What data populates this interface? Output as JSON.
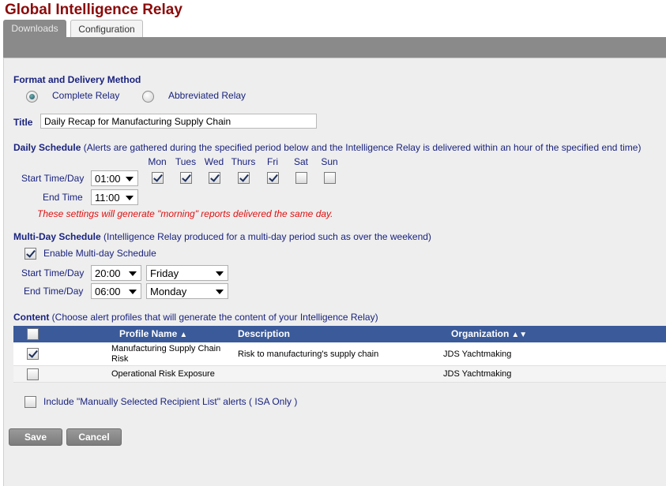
{
  "app": {
    "title": "Global Intelligence Relay"
  },
  "tabs": [
    {
      "label": "Downloads"
    },
    {
      "label": "Configuration"
    }
  ],
  "format": {
    "heading": "Format and Delivery Method",
    "options": [
      {
        "label": "Complete Relay",
        "selected": true
      },
      {
        "label": "Abbreviated Relay",
        "selected": false
      }
    ]
  },
  "title_field": {
    "label": "Title",
    "value": "Daily Recap for Manufacturing Supply Chain"
  },
  "daily": {
    "heading": "Daily Schedule",
    "note": "(Alerts are gathered during the specified period below and the Intelligence Relay is delivered within an hour of the specified end time)",
    "days": [
      {
        "label": "Mon",
        "checked": true
      },
      {
        "label": "Tues",
        "checked": true
      },
      {
        "label": "Wed",
        "checked": true
      },
      {
        "label": "Thurs",
        "checked": true
      },
      {
        "label": "Fri",
        "checked": true
      },
      {
        "label": "Sat",
        "checked": false
      },
      {
        "label": "Sun",
        "checked": false
      }
    ],
    "start_label": "Start Time/Day",
    "start_value": "01:00",
    "end_label": "End Time",
    "end_value": "11:00",
    "warning": "These settings will generate \"morning\" reports delivered the same day."
  },
  "multiday": {
    "heading": "Multi-Day Schedule",
    "note": "(Intelligence Relay produced for a multi-day period such as over the weekend)",
    "enable_label": "Enable Multi-day Schedule",
    "enabled": true,
    "start_label": "Start Time/Day",
    "start_time": "20:00",
    "start_day": "Friday",
    "end_label": "End Time/Day",
    "end_time": "06:00",
    "end_day": "Monday"
  },
  "content": {
    "heading": "Content",
    "note": "(Choose alert profiles that will generate the content of your Intelligence Relay)",
    "columns": {
      "profile": "Profile Name",
      "description": "Description",
      "organization": "Organization"
    },
    "rows": [
      {
        "checked": true,
        "profile_line1": "Manufacturing Supply Chain",
        "profile_line2": "Risk",
        "description": "Risk to manufacturing's supply chain",
        "organization": "JDS Yachtmaking"
      },
      {
        "checked": false,
        "profile_line1": "Operational Risk Exposure",
        "profile_line2": "",
        "description": "",
        "organization": "JDS Yachtmaking"
      }
    ]
  },
  "manual_list": {
    "label": "Include \"Manually Selected Recipient List\" alerts ( ISA Only )",
    "checked": false
  },
  "buttons": {
    "save": "Save",
    "cancel": "Cancel"
  },
  "colors": {
    "title": "#8b0a0a",
    "section_text": "#1a237e",
    "warning": "#e01010",
    "table_header": "#3a5a9a"
  }
}
